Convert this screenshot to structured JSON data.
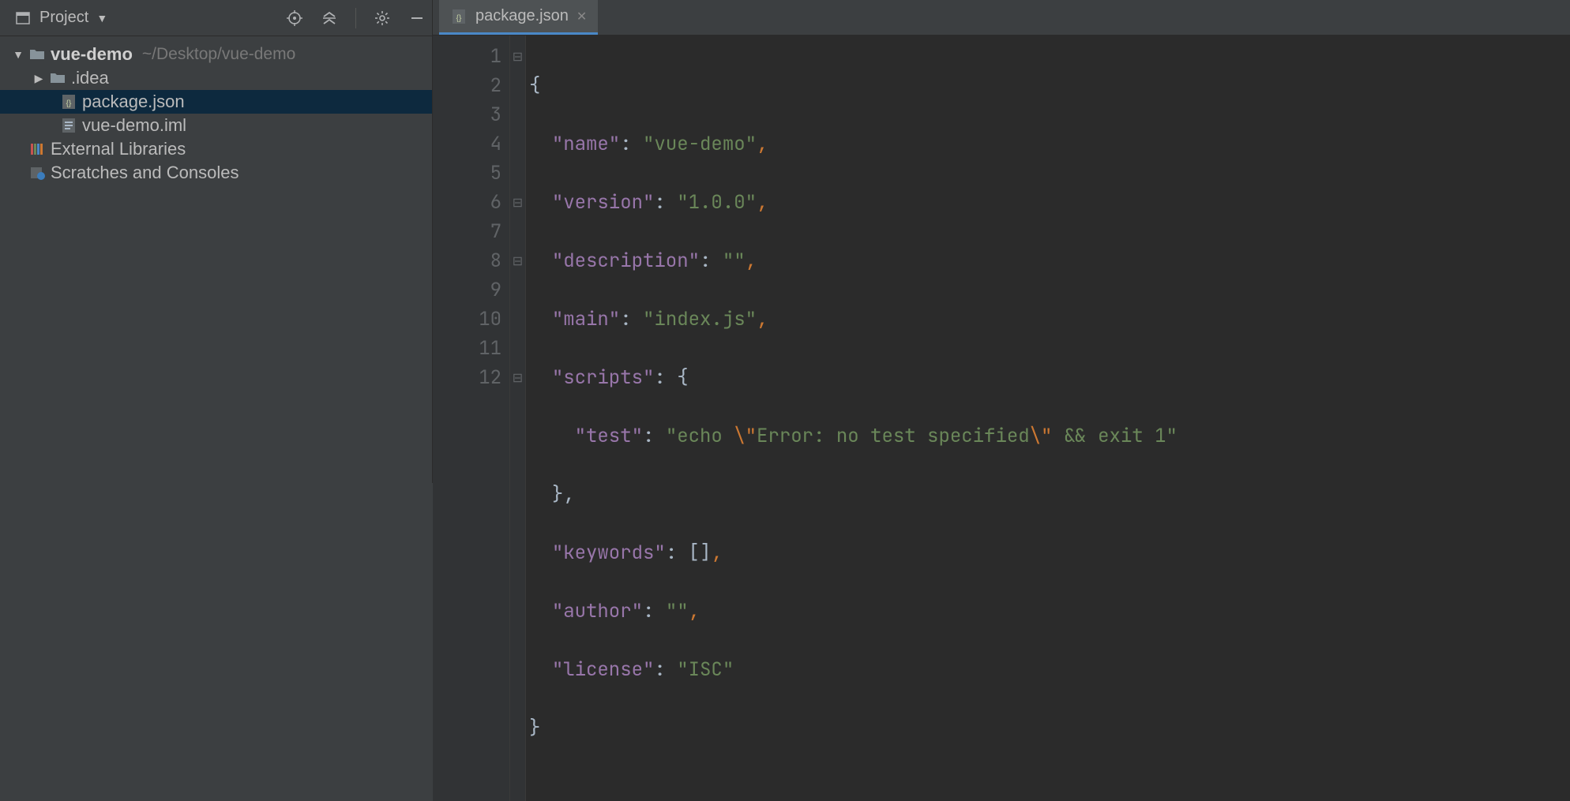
{
  "sidebar": {
    "title": "Project",
    "tree": {
      "root_name": "vue-demo",
      "root_path": "~/Desktop/vue-demo",
      "items": [
        {
          "label": ".idea"
        },
        {
          "label": "package.json"
        },
        {
          "label": "vue-demo.iml"
        }
      ],
      "external": "External Libraries",
      "scratches": "Scratches and Consoles"
    }
  },
  "tab": {
    "label": "package.json"
  },
  "editor": {
    "lines": [
      "1",
      "2",
      "3",
      "4",
      "5",
      "6",
      "7",
      "8",
      "9",
      "10",
      "11",
      "12"
    ]
  },
  "code": {
    "k_name": "\"name\"",
    "v_name": "\"vue-demo\"",
    "k_version": "\"version\"",
    "v_version": "\"1.0.0\"",
    "k_desc": "\"description\"",
    "v_desc": "\"\"",
    "k_main": "\"main\"",
    "v_main": "\"index.js\"",
    "k_scripts": "\"scripts\"",
    "k_test": "\"test\"",
    "v_test_a": "\"echo ",
    "v_test_e1": "\\\"",
    "v_test_b": "Error: no test specified",
    "v_test_e2": "\\\"",
    "v_test_c": " && exit 1\"",
    "k_keywords": "\"keywords\"",
    "k_author": "\"author\"",
    "v_author": "\"\"",
    "k_license": "\"license\"",
    "v_license": "\"ISC\"",
    "brace_o": "{",
    "brace_c": "}",
    "colon": ": ",
    "comma": ",",
    "brackets": "[]",
    "brace_c_comma": "},"
  }
}
